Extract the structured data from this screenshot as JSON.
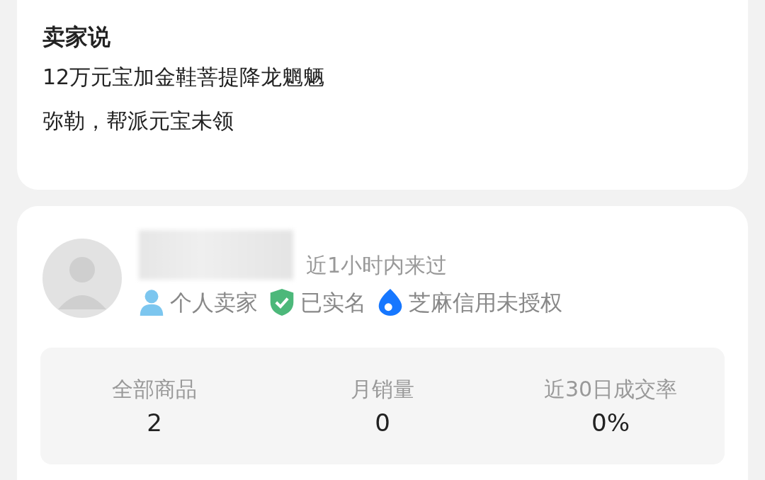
{
  "seller_says": {
    "title": "卖家说",
    "lines": [
      "12万元宝加金鞋菩提降龙魍魉",
      "弥勒，帮派元宝未领"
    ]
  },
  "seller": {
    "last_seen": "近1小时内来过",
    "badges": [
      {
        "kind": "person",
        "label": "个人卖家"
      },
      {
        "kind": "verified",
        "label": "已实名"
      },
      {
        "kind": "credit",
        "label": "芝麻信用未授权"
      }
    ],
    "stats": [
      {
        "label": "全部商品",
        "value": "2"
      },
      {
        "label": "月销量",
        "value": "0"
      },
      {
        "label": "近30日成交率",
        "value": "0%"
      }
    ]
  }
}
